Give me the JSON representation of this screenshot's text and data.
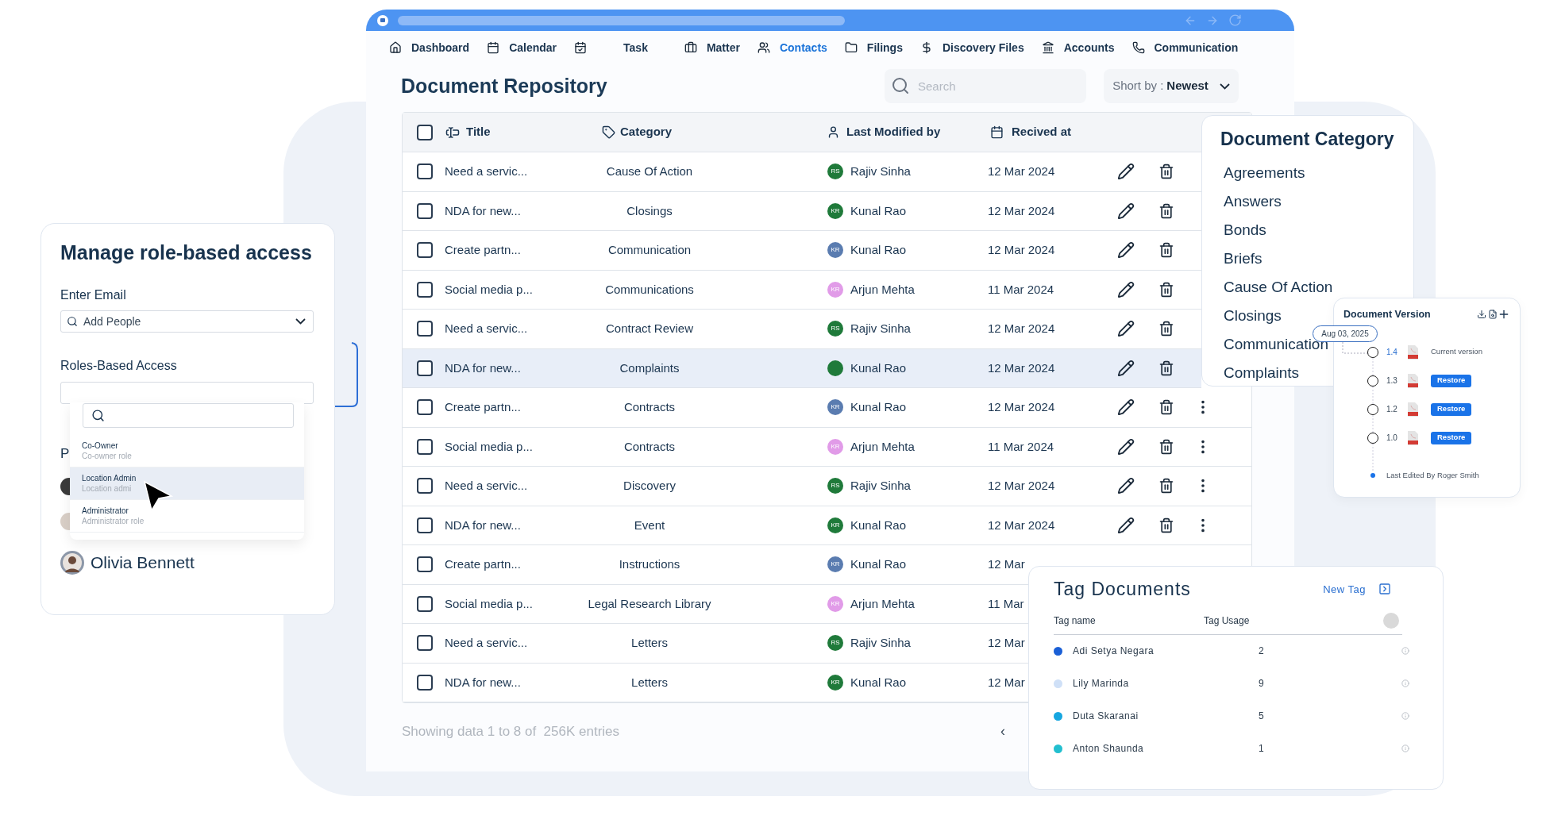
{
  "browser": {
    "kind": "browser"
  },
  "nav": [
    {
      "label": "Dashboard",
      "selected": false
    },
    {
      "label": "Calendar",
      "selected": false
    },
    {
      "label": "Task",
      "selected": false
    },
    {
      "label": "Matter",
      "selected": false
    },
    {
      "label": "Contacts",
      "selected": true
    },
    {
      "label": "Filings",
      "selected": false
    },
    {
      "label": "Discovery Files",
      "selected": false
    },
    {
      "label": "Accounts",
      "selected": false
    },
    {
      "label": "Communication",
      "selected": false
    }
  ],
  "page_title": "Document Repository",
  "search": {
    "placeholder": "Search"
  },
  "sort": {
    "label": "Short by :",
    "value": "Newest"
  },
  "table": {
    "select_all": {
      "checked": false
    },
    "columns": [
      "Title",
      "Category",
      "Last Modified by",
      "Recived at"
    ],
    "rows": [
      {
        "title": "Need a servic...",
        "category": "Cause Of Action",
        "initials": "RS",
        "color": "#1f7a3a",
        "name": "Rajiv Sinha",
        "date": "12 Mar 2024",
        "checked": false,
        "selected": false,
        "actions": true,
        "menu": false
      },
      {
        "title": "NDA for new...",
        "category": "Closings",
        "initials": "KR",
        "color": "#1f7a3a",
        "name": "Kunal Rao",
        "date": "12 Mar 2024",
        "checked": false,
        "selected": false,
        "actions": true,
        "menu": false
      },
      {
        "title": "Create partn...",
        "category": "Communication",
        "initials": "KR",
        "color": "#5a7cb0",
        "name": "Kunal Rao",
        "date": "12 Mar 2024",
        "checked": false,
        "selected": false,
        "actions": true,
        "menu": false
      },
      {
        "title": "Social media p...",
        "category": "Communications",
        "initials": "KR",
        "color": "#e19be8",
        "name": "Arjun Mehta",
        "date": "11 Mar 2024",
        "checked": false,
        "selected": false,
        "actions": true,
        "menu": false
      },
      {
        "title": "Need a servic...",
        "category": "Contract Review",
        "initials": "RS",
        "color": "#1f7a3a",
        "name": "Rajiv Sinha",
        "date": "12 Mar 2024",
        "checked": false,
        "selected": false,
        "actions": true,
        "menu": false
      },
      {
        "title": "NDA for new...",
        "category": "Complaints",
        "color": "#1f7a3a",
        "name": "Kunal Rao",
        "date": "12 Mar 2024",
        "checked": false,
        "selected": true,
        "actions": true,
        "menu": false
      },
      {
        "title": "Create partn...",
        "category": "Contracts",
        "initials": "KR",
        "color": "#5a7cb0",
        "name": "Kunal Rao",
        "date": "12 Mar 2024",
        "checked": false,
        "selected": false,
        "actions": true,
        "menu": true
      },
      {
        "title": "Social media p...",
        "category": "Contracts",
        "initials": "KR",
        "color": "#e19be8",
        "name": "Arjun Mehta",
        "date": "11 Mar 2024",
        "checked": false,
        "selected": false,
        "actions": true,
        "menu": true
      },
      {
        "title": "Need a servic...",
        "category": "Discovery",
        "initials": "RS",
        "color": "#1f7a3a",
        "name": "Rajiv Sinha",
        "date": "12 Mar 2024",
        "checked": false,
        "selected": false,
        "actions": true,
        "menu": true
      },
      {
        "title": "NDA for new...",
        "category": "Event",
        "initials": "KR",
        "color": "#1f7a3a",
        "name": "Kunal Rao",
        "date": "12 Mar 2024",
        "checked": false,
        "selected": false,
        "actions": true,
        "menu": true
      },
      {
        "title": "Create partn...",
        "category": "Instructions",
        "initials": "KR",
        "color": "#5a7cb0",
        "name": "Kunal Rao",
        "date": "12 Mar",
        "checked": false,
        "selected": false,
        "actions": false,
        "menu": false
      },
      {
        "title": "Social media p...",
        "category": "Legal Research Library",
        "initials": "KR",
        "color": "#e19be8",
        "name": "Arjun Mehta",
        "date": "11 Mar",
        "checked": false,
        "selected": false,
        "actions": false,
        "menu": false
      },
      {
        "title": "Need a servic...",
        "category": "Letters",
        "initials": "RS",
        "color": "#1f7a3a",
        "name": "Rajiv Sinha",
        "date": "12 Mar",
        "checked": false,
        "selected": false,
        "actions": false,
        "menu": false
      },
      {
        "title": "NDA for new...",
        "category": "Letters",
        "initials": "KR",
        "color": "#1f7a3a",
        "name": "Kunal Rao",
        "date": "12 Mar",
        "checked": false,
        "selected": false,
        "actions": false,
        "menu": false
      }
    ]
  },
  "footer": {
    "summary": "Showing data 1 to 8 of  256K entries",
    "pager": "‹"
  },
  "category_card": {
    "title": "Document Category",
    "items": [
      "Agreements",
      "Answers",
      "Bonds",
      "Briefs",
      "Cause Of Action",
      "Closings",
      "Communication",
      "Complaints"
    ]
  },
  "version_card": {
    "title": "Document Version",
    "date": "Aug 03, 2025",
    "versions": [
      {
        "number": "1.4",
        "kind": "current",
        "label": "Current version",
        "selected": false
      },
      {
        "number": "1.3",
        "kind": "restore",
        "label": "Restore",
        "selected": false
      },
      {
        "number": "1.2",
        "kind": "restore",
        "label": "Restore",
        "selected": false
      },
      {
        "number": "1.0",
        "kind": "restore",
        "label": "Restore",
        "selected": false
      }
    ],
    "footer": "Last Edited By Roger Smith"
  },
  "tag_card": {
    "title": "Tag Documents",
    "action": "New Tag",
    "columns": [
      "Tag name",
      "Tag Usage"
    ],
    "rows": [
      {
        "name": "Adi Setya Negara",
        "usage": "2",
        "color": "#1a5fd6"
      },
      {
        "name": "Lily Marinda",
        "usage": "9",
        "color": "#cfe0f7"
      },
      {
        "name": "Duta Skaranai",
        "usage": "5",
        "color": "#16a6e0"
      },
      {
        "name": "Anton Shaunda",
        "usage": "1",
        "color": "#22bfcf"
      }
    ]
  },
  "access_card": {
    "title": "Manage role-based access",
    "email_label": "Enter Email",
    "email_placeholder": "Add People",
    "roles_label": "Roles-Based Access",
    "hidden_label": "P",
    "roles": [
      {
        "name": "Co-Owner",
        "description": "Co-owner role",
        "selected": false
      },
      {
        "name": "Location Admin",
        "description": "Location admi",
        "selected": true
      },
      {
        "name": "Administrator",
        "description": "Administrator role",
        "selected": false
      }
    ],
    "person": "Olivia Bennett"
  }
}
